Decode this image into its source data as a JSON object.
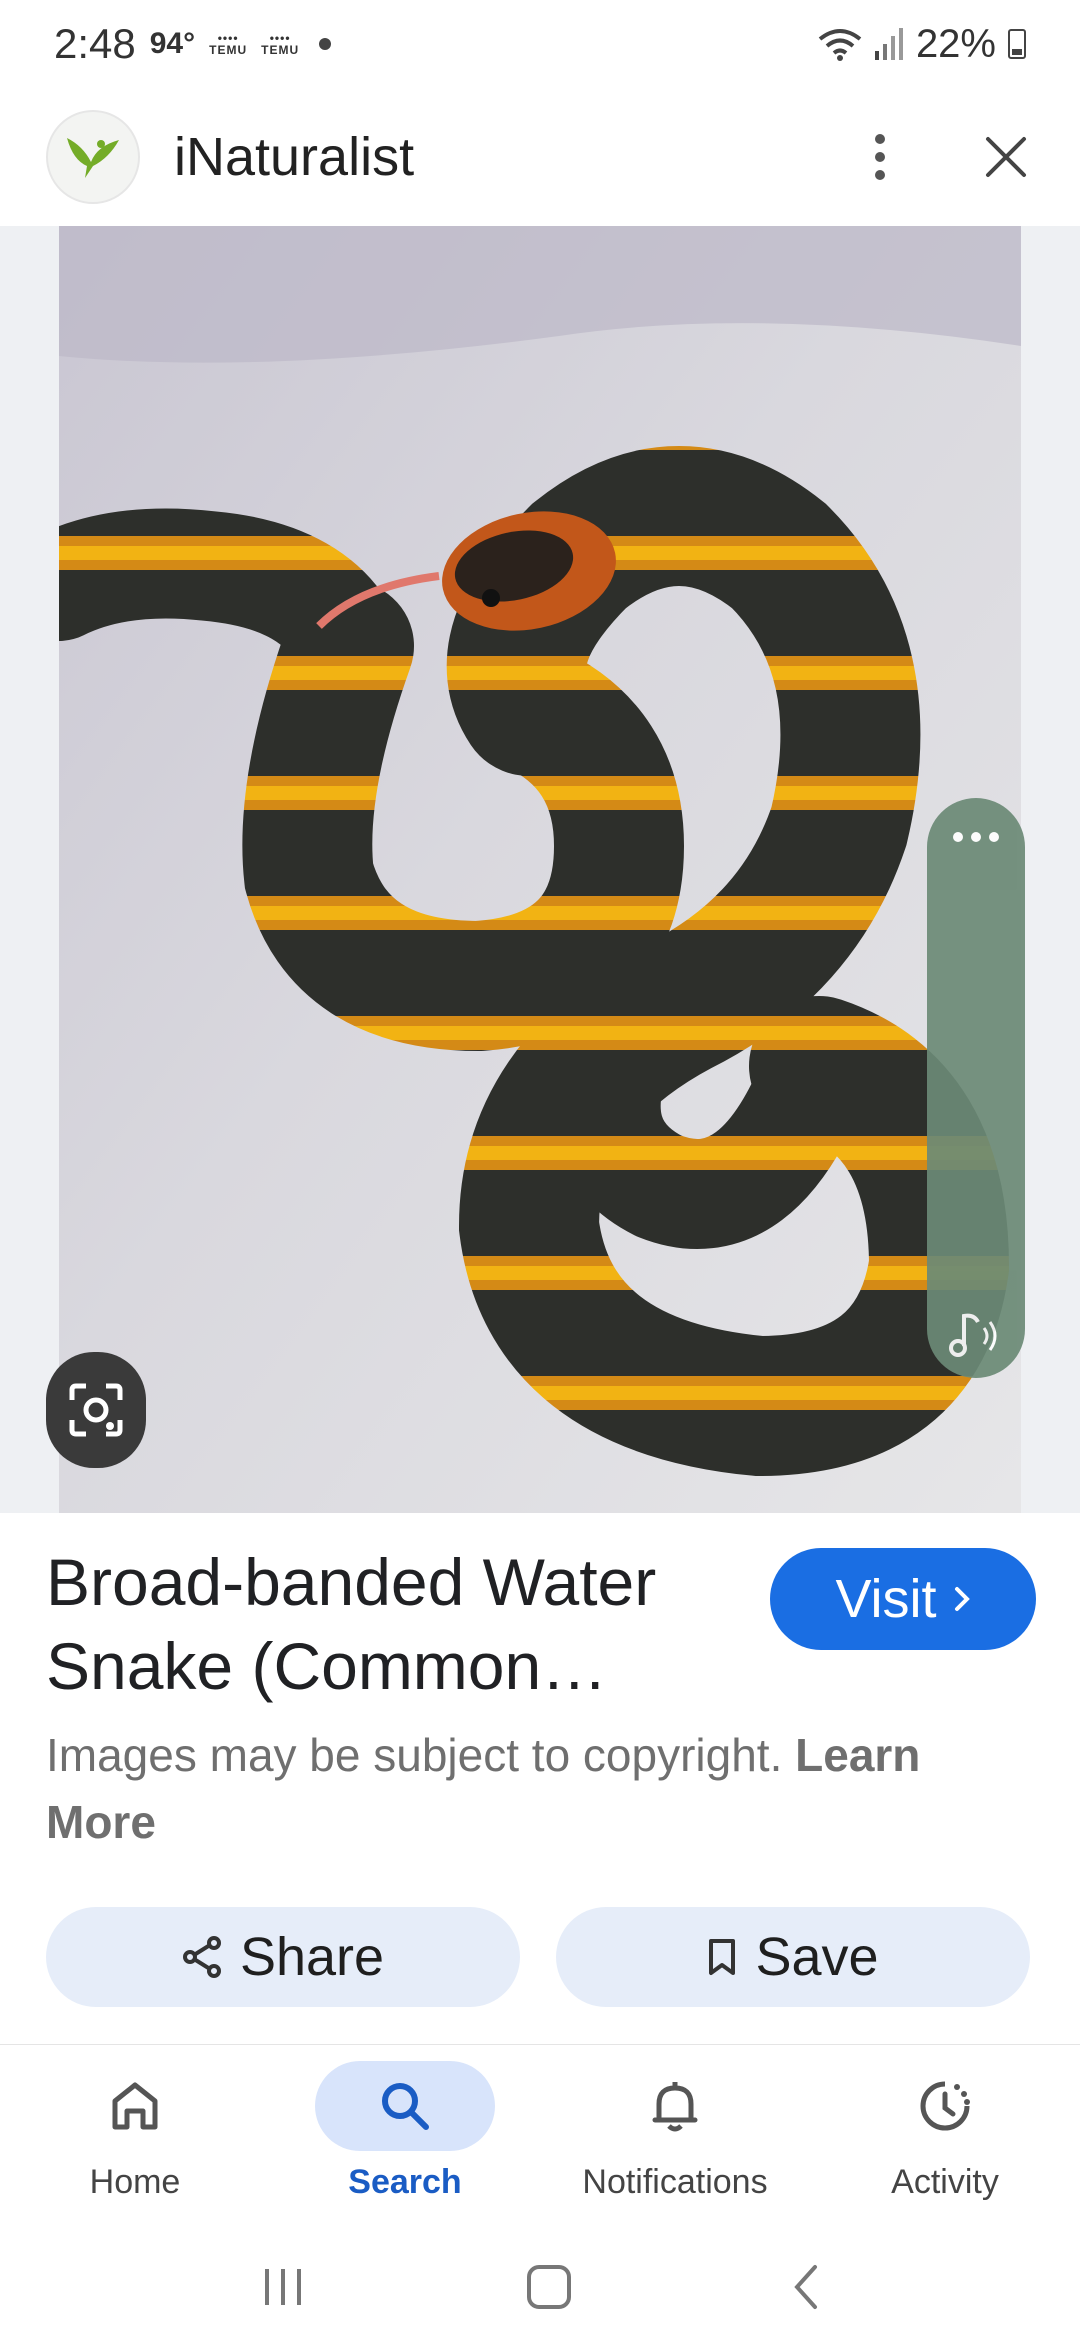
{
  "status_bar": {
    "time": "2:48",
    "temperature": "94°",
    "temu_1": "TEMU",
    "temu_2": "TEMU",
    "battery": "22%"
  },
  "app_header": {
    "title": "iNaturalist"
  },
  "result": {
    "title": "Broad-banded Water Snake (Common…",
    "visit_label": "Visit",
    "copyright_text": "Images may be subject to copyright.",
    "learn_more": "Learn More"
  },
  "actions": {
    "share": "Share",
    "save": "Save"
  },
  "bottom_nav": {
    "items": [
      {
        "label": "Home",
        "icon": "home-icon"
      },
      {
        "label": "Search",
        "icon": "search-icon",
        "active": true
      },
      {
        "label": "Notifications",
        "icon": "bell-icon"
      },
      {
        "label": "Activity",
        "icon": "activity-icon"
      }
    ]
  },
  "colors": {
    "accent": "#1a6ee3",
    "pill_bg": "#e6edf9",
    "nav_active_bg": "#d8e4fb"
  }
}
